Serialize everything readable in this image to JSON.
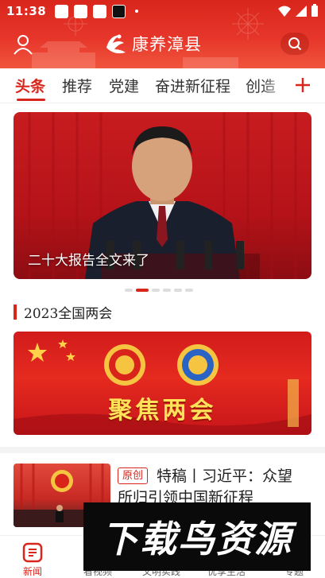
{
  "status_bar": {
    "time": "11:38"
  },
  "header": {
    "app_name": "康养漳县"
  },
  "tabs": [
    {
      "label": "头条",
      "active": true
    },
    {
      "label": "推荐",
      "active": false
    },
    {
      "label": "党建",
      "active": false
    },
    {
      "label": "奋进新征程",
      "active": false
    },
    {
      "label": "创造",
      "active": false
    }
  ],
  "banner": {
    "caption": "二十大报告全文来了",
    "slide_count": 6,
    "active_slide": 1
  },
  "section": {
    "title": "2023全国两会"
  },
  "feature": {
    "title": "聚焦两会"
  },
  "news": [
    {
      "tag": "原创",
      "title_line1": "特稿丨习近平：众望",
      "title_line2": "所归引领中国新征程"
    }
  ],
  "bottom_nav": [
    {
      "label": "新闻",
      "icon": "news-icon",
      "active": true
    },
    {
      "label": "看视频",
      "icon": "video-icon",
      "active": false
    },
    {
      "label": "文明实践",
      "icon": "practice-icon",
      "active": false
    },
    {
      "label": "优享生活",
      "icon": "life-icon",
      "active": false
    },
    {
      "label": "专题",
      "icon": "topic-icon",
      "active": false
    }
  ],
  "watermark": {
    "text": "下载鸟资源"
  },
  "colors": {
    "accent": "#d9261c",
    "header_bg": "#e6352a",
    "feature_title": "#ffe25a"
  }
}
